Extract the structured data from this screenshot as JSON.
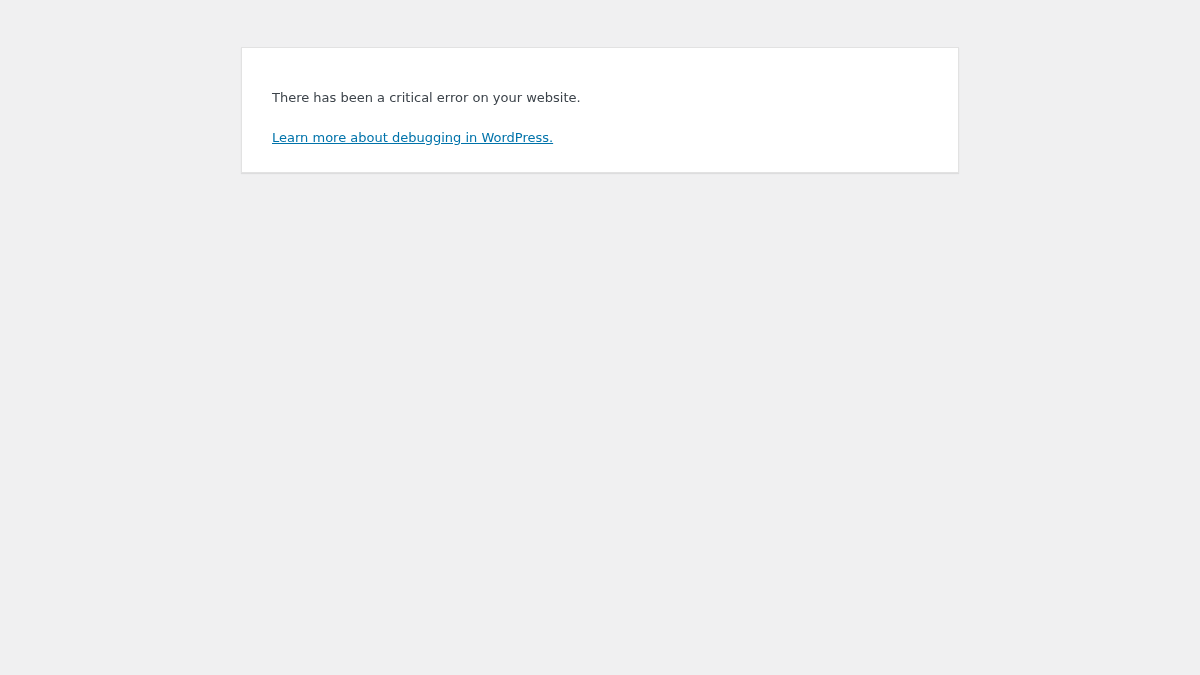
{
  "error_message": "There has been a critical error on your website.",
  "help_link": "Learn more about debugging in WordPress."
}
